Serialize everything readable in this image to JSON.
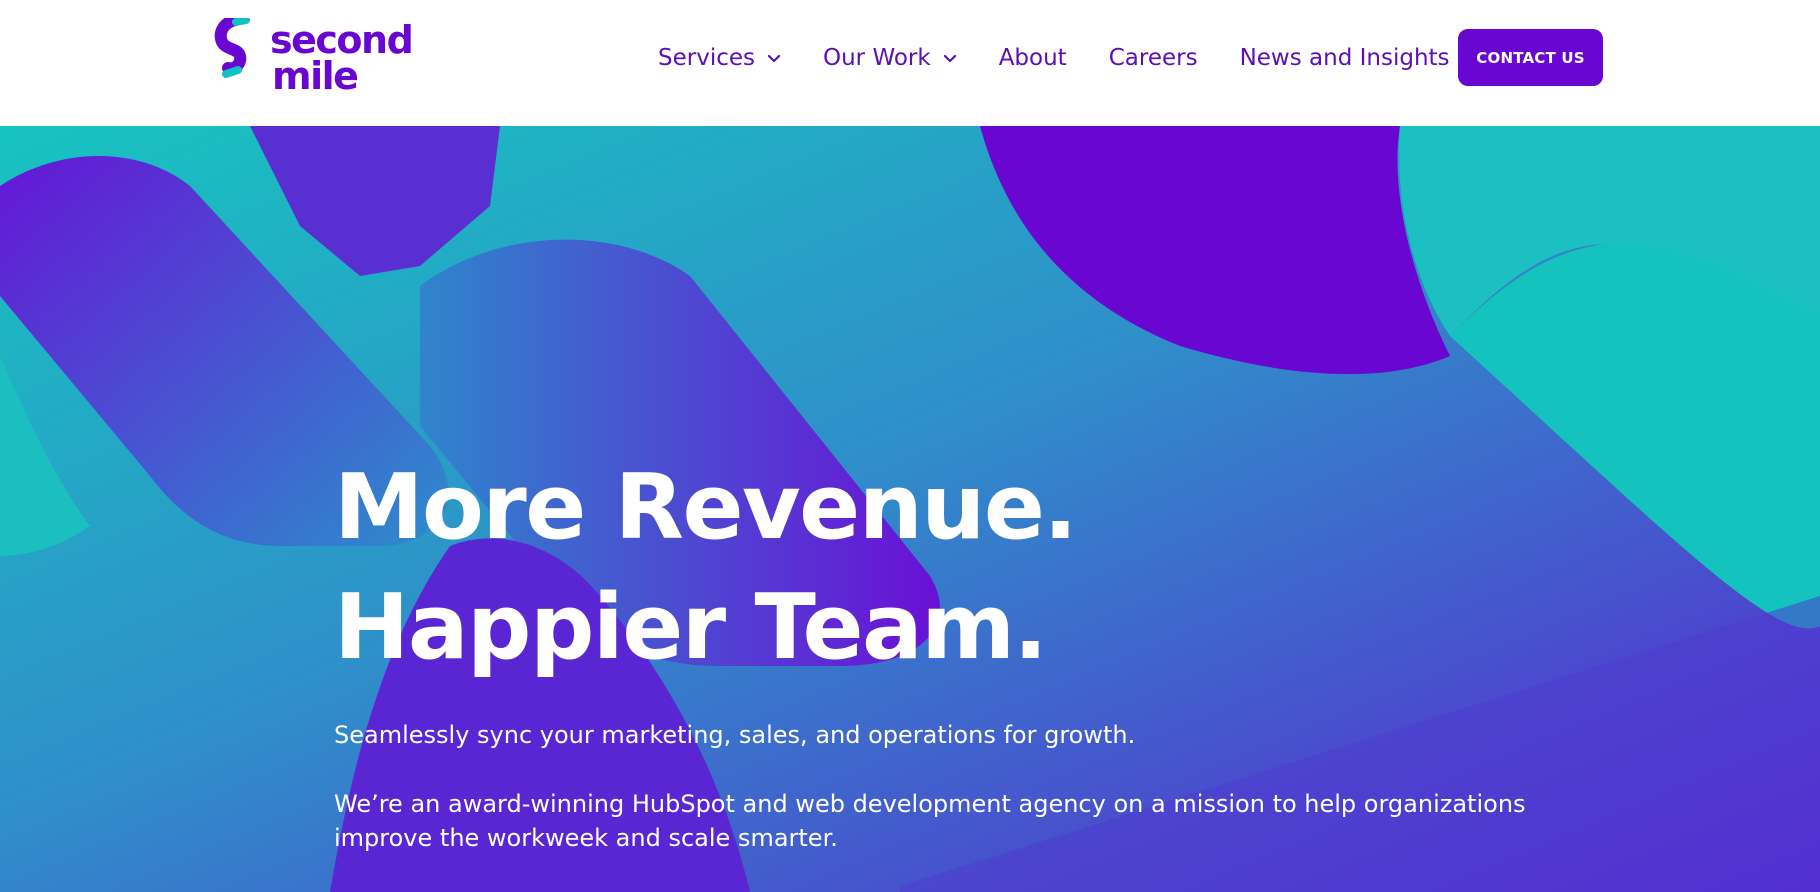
{
  "brand": {
    "logo_line1": "second",
    "logo_line2": "mile",
    "primary_color": "#6a06d2",
    "accent_color": "#12c2bf"
  },
  "nav": {
    "items": [
      {
        "label": "Services",
        "has_dropdown": true
      },
      {
        "label": "Our Work",
        "has_dropdown": true
      },
      {
        "label": "About",
        "has_dropdown": false
      },
      {
        "label": "Careers",
        "has_dropdown": false
      },
      {
        "label": "News and Insights",
        "has_dropdown": false
      }
    ],
    "contact_label": "CONTACT US"
  },
  "hero": {
    "title_line1": "More Revenue.",
    "title_line2": "Happier Team.",
    "subtitle": "Seamlessly sync your marketing, sales, and operations for growth.",
    "description": "We’re an award-winning HubSpot and web development agency on a mission to help organizations improve the workweek and scale smarter."
  },
  "icons": {
    "logo_mark": "s-swoosh-logo-icon",
    "dropdown": "chevron-down-icon"
  }
}
